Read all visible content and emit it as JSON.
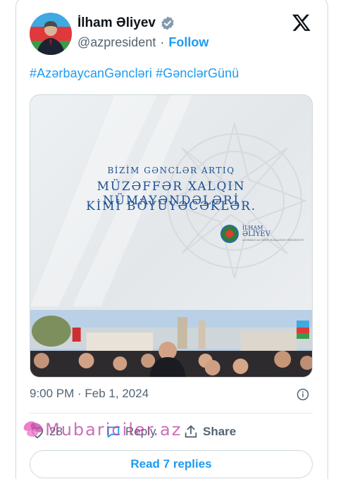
{
  "user": {
    "name": "İlham Əliyev",
    "handle": "@azpresident",
    "separator": "·",
    "follow_label": "Follow"
  },
  "tweet": {
    "hashtags": [
      "#AzərbaycanGəncləri",
      "#GənclərGünü"
    ],
    "timestamp": "9:00 PM · Feb 1, 2024"
  },
  "media": {
    "line1": "BİZİM GƏNCLƏR ARTIQ",
    "line2": "MÜZƏFFƏR XALQIN NÜMAYƏNDƏLƏRİ",
    "line3": "KİMİ BÖYÜYƏCƏKLƏR.",
    "signature_line1": "İLHAM",
    "signature_line2": "ƏLİYEV",
    "signature_line3": "AZƏRBAYCAN RESPUBLİKASININ PREZİDENTİ"
  },
  "actions": {
    "likes_count": "28",
    "reply_label": "Reply",
    "share_label": "Share"
  },
  "read_replies_label": "Read 7 replies",
  "watermark_text": "Mubariciler.az",
  "colors": {
    "accent": "#1d9bf0",
    "text_primary": "#0f1419",
    "text_secondary": "#536471",
    "border": "#cfd9de",
    "watermark": "#ba40a0"
  },
  "icons": {
    "verified": "verified-badge-icon",
    "x_logo": "x-logo-icon",
    "info": "info-icon",
    "like": "heart-icon",
    "reply": "reply-bubble-icon",
    "share": "share-icon"
  }
}
